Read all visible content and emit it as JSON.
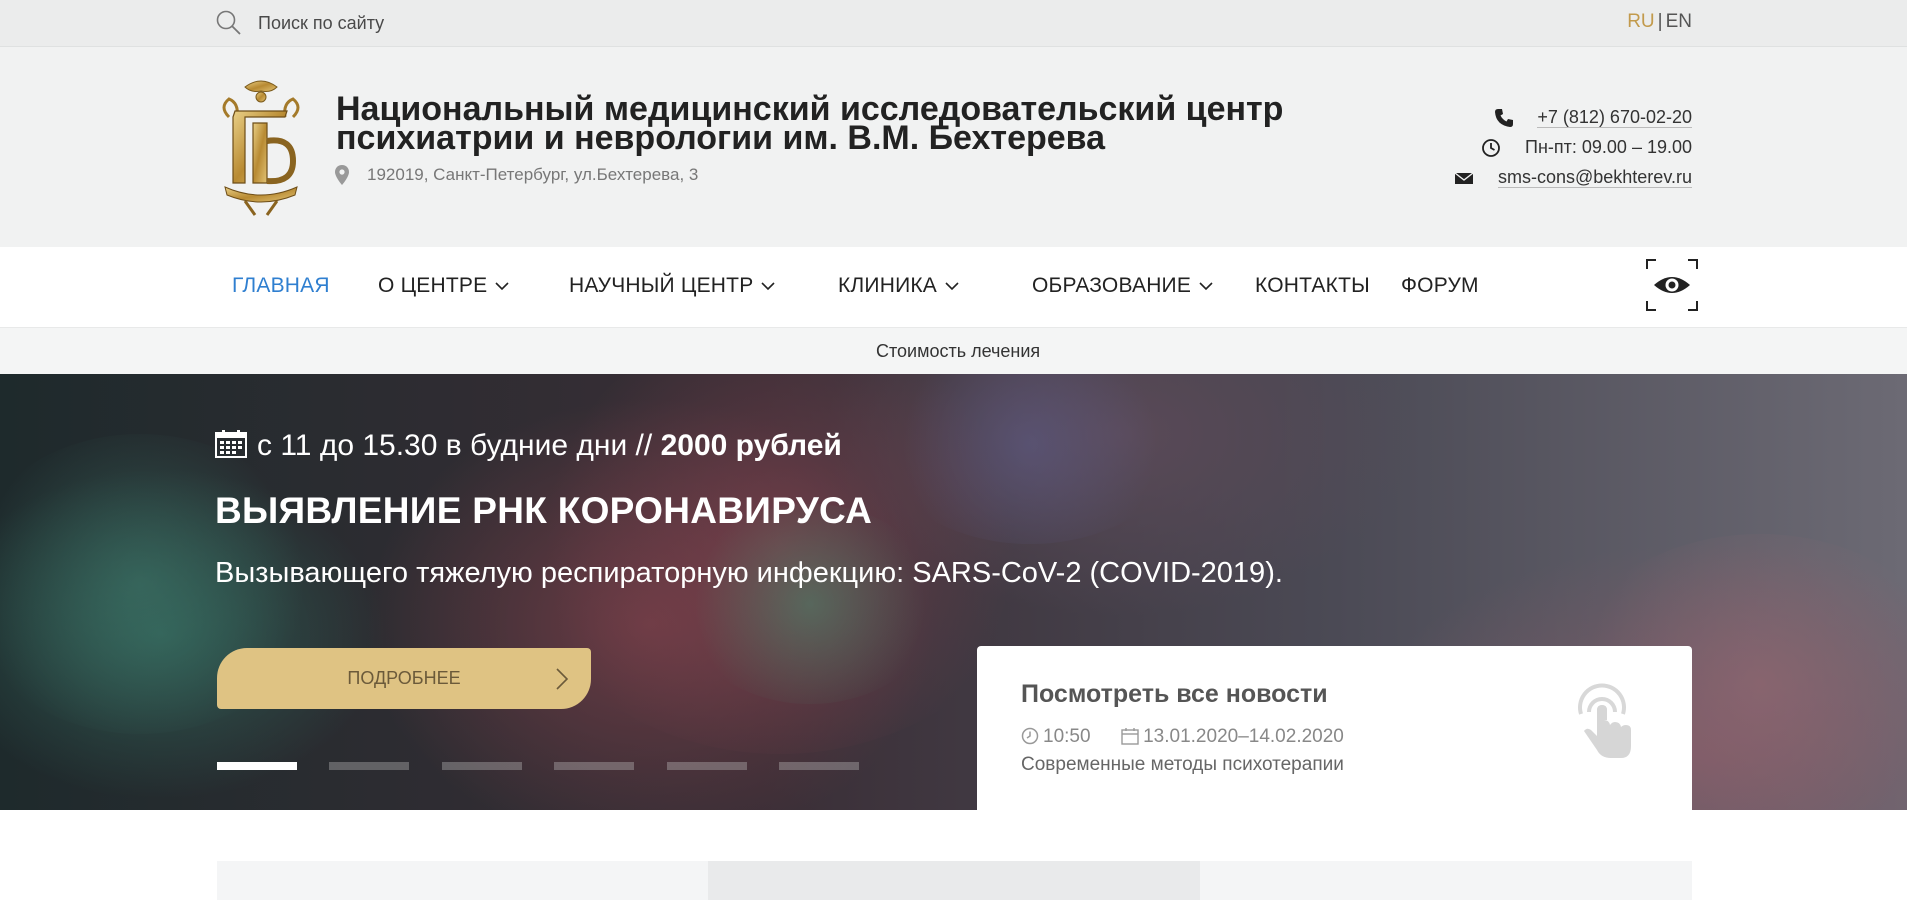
{
  "search": {
    "placeholder": "Поиск по сайту"
  },
  "lang": {
    "ru": "RU",
    "en": "EN",
    "active": "RU"
  },
  "header": {
    "org_name": "Национальный медицинский исследовательский центр психиатрии и неврологии им. В.М. Бехтерева",
    "address": "192019, Санкт-Петербург, ул.Бехтерева, 3",
    "phone": "+7 (812) 670-02-20",
    "hours": "Пн-пт: 09.00 – 19.00",
    "email": "sms-cons@bekhterev.ru"
  },
  "nav": {
    "items": [
      {
        "label": "ГЛАВНАЯ",
        "active": true,
        "dropdown": false
      },
      {
        "label": "О ЦЕНТРЕ",
        "active": false,
        "dropdown": true
      },
      {
        "label": "НАУЧНЫЙ ЦЕНТР",
        "active": false,
        "dropdown": true
      },
      {
        "label": "КЛИНИКА",
        "active": false,
        "dropdown": true
      },
      {
        "label": "ОБРАЗОВАНИЕ",
        "active": false,
        "dropdown": true
      },
      {
        "label": "КОНТАКТЫ",
        "active": false,
        "dropdown": false
      },
      {
        "label": "ФОРУМ",
        "active": false,
        "dropdown": false
      }
    ],
    "accessibility_icon": "eye-icon"
  },
  "subnav": {
    "label": "Стоимость лечения"
  },
  "hero": {
    "schedule_prefix": "с 11 до 15.30 в будние дни // ",
    "schedule_price": "2000 рублей",
    "title": "ВЫЯВЛЕНИЕ РНК КОРОНАВИРУСА",
    "subtitle": "Вызывающего тяжелую респираторную инфекцию: SARS-CoV-2 (COVID-2019).",
    "button_label": "ПОДРОБНЕЕ",
    "slide_count": 6,
    "active_slide": 1
  },
  "news": {
    "title": "Посмотреть все новости",
    "time": "10:50",
    "dates": "13.01.2020–14.02.2020",
    "description": "Современные методы психотерапии"
  },
  "colors": {
    "accent_gold": "#dfc383",
    "lang_active": "#c29a4c",
    "nav_active": "#2f7fd0",
    "topbar_bg": "#ebecec",
    "header_bg": "#f1f2f2"
  }
}
